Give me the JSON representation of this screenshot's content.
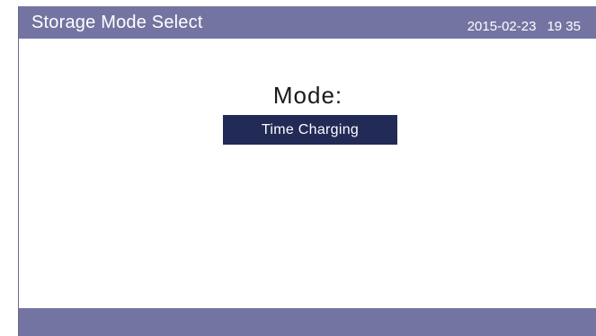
{
  "header": {
    "title": "Storage Mode Select",
    "date": "2015-02-23",
    "time": "19 35"
  },
  "main": {
    "mode_label": "Mode:",
    "mode_value": "Time Charging"
  },
  "colors": {
    "bar": "#7474a3",
    "selected": "#222a56"
  }
}
